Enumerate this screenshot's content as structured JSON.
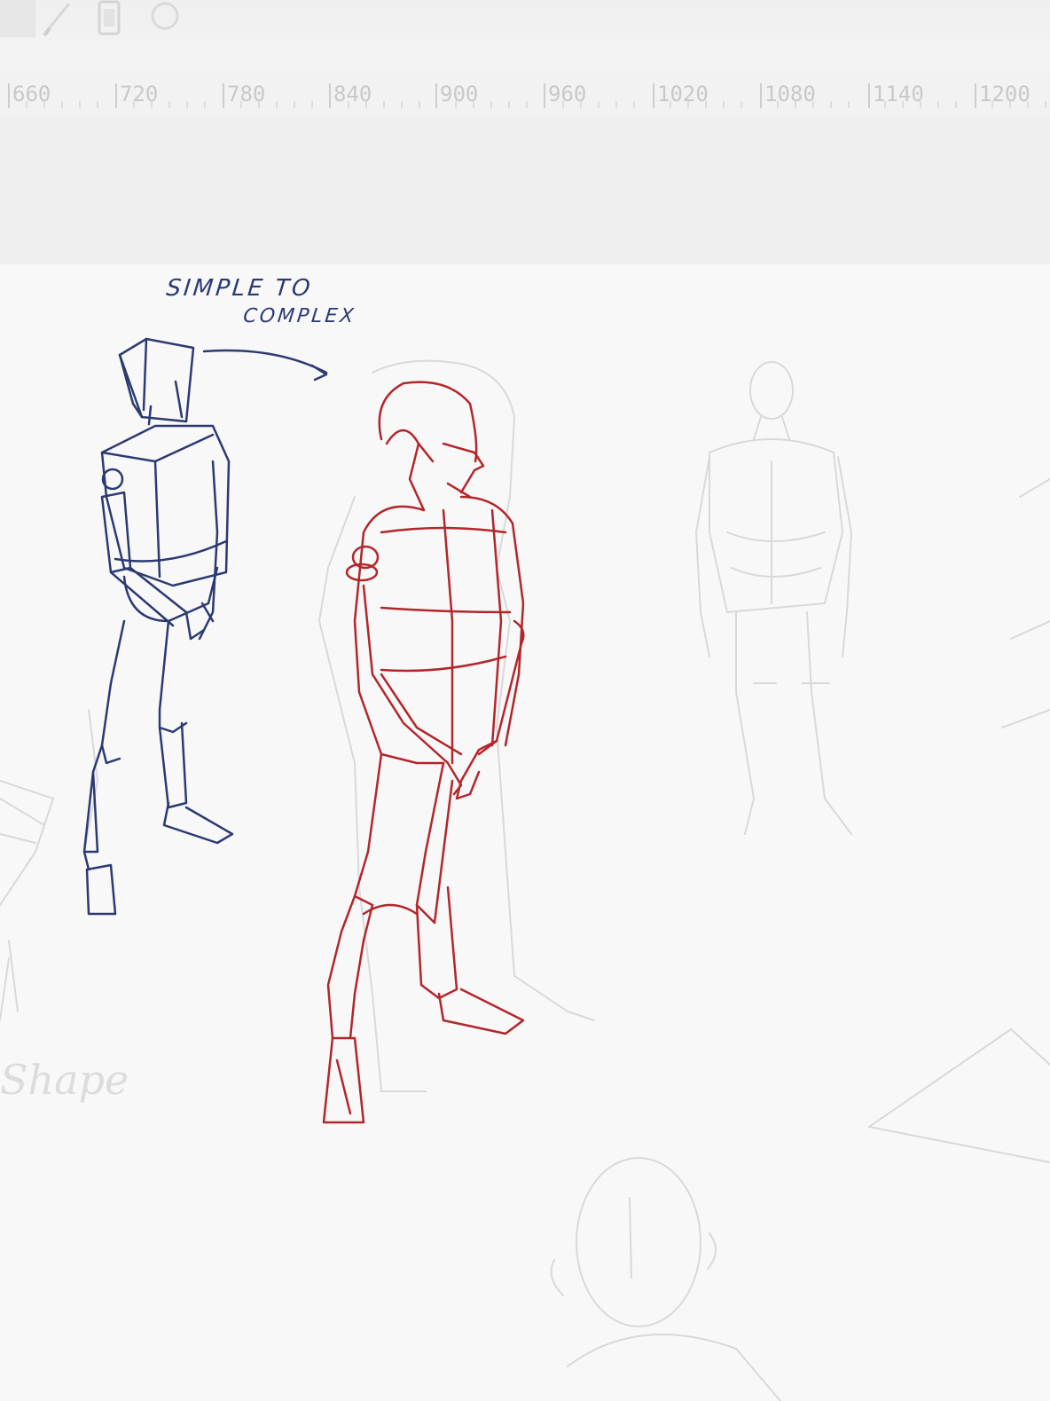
{
  "ruler": {
    "ticks": [
      "660",
      "720",
      "780",
      "840",
      "900",
      "960",
      "1020",
      "1080",
      "1140",
      "1200"
    ]
  },
  "toolbar": {
    "tools": [
      {
        "icon": "pen-icon"
      },
      {
        "icon": "tablet-icon"
      },
      {
        "icon": "brush-icon"
      }
    ]
  },
  "canvas": {
    "annotation_line1": "SIMPLE TO",
    "annotation_line2": "COMPLEX",
    "faded_note": "Shape"
  },
  "colors": {
    "blue_ink": "#2c3a74",
    "red_ink": "#b3262b",
    "faded_pencil": "#d6d6d6",
    "canvas_bg": "#f8f8f8",
    "chrome_bg": "#efefef"
  }
}
